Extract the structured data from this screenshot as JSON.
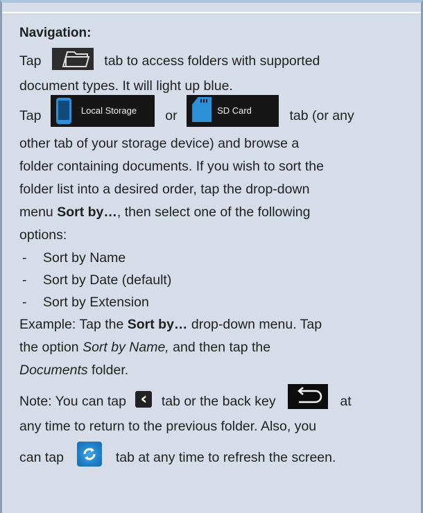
{
  "heading": "Navigation:",
  "p1": {
    "a": "Tap",
    "b": "tab to access folders with supported",
    "c": "document types. It will light up blue."
  },
  "p2": {
    "tap": "Tap",
    "local_label": "Local Storage",
    "or": "or",
    "sd_label": "SD Card",
    "tail": "tab (or any",
    "l2": "other tab of your storage device) and browse a",
    "l3": "folder containing documents. If you wish to sort the",
    "l4": "folder list into a desired order, tap the drop-down",
    "l5a": "menu",
    "l5b": "Sort by…",
    "l5c": ", then select one of the following",
    "l6": "options:"
  },
  "list": {
    "dash": "-",
    "items": [
      "Sort by Name",
      "Sort by Date (default)",
      "Sort by Extension"
    ]
  },
  "example": {
    "a": "Example: Tap the",
    "b": "Sort by…",
    "c": "drop-down menu. Tap",
    "d": "the option",
    "e": "Sort by Name,",
    "f": "and then tap the",
    "g": "Documents",
    "h": "folder."
  },
  "note": {
    "a": "Note: You can tap",
    "b": "tab or the back key",
    "c": "at",
    "d": "any time to return to the previous folder. Also, you",
    "e": "can tap",
    "f": "tab at any time to refresh the screen."
  },
  "icons": {
    "folder": "folder-icon",
    "local_storage": "tablet-icon",
    "sd_card": "sd-card-icon",
    "back": "chevron-left-icon",
    "back_key": "return-arrow-icon",
    "refresh": "refresh-icon"
  },
  "colors": {
    "background": "#d6dde9",
    "accent_blue": "#2a90d8"
  }
}
